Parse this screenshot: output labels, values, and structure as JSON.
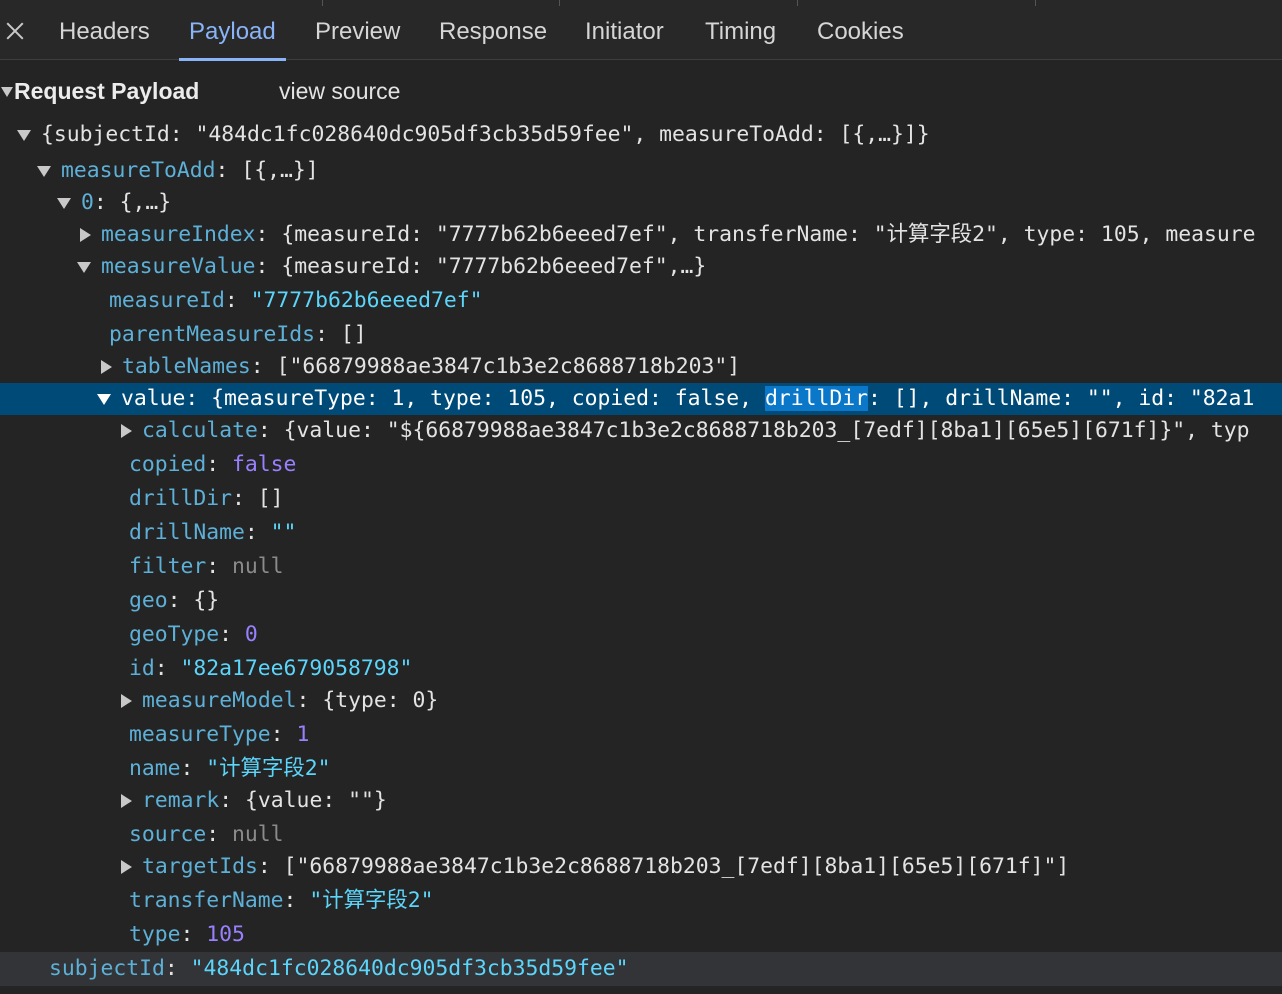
{
  "colors": {
    "background": "#242424",
    "selected_row": "#004a77",
    "accent_tab": "#8ab4f8",
    "key": "#5db0d7",
    "string": "#5cd5fb",
    "number": "#9980ff",
    "null": "#8b8b8b"
  },
  "tabs": [
    "Headers",
    "Payload",
    "Preview",
    "Response",
    "Initiator",
    "Timing",
    "Cookies"
  ],
  "active_tab": "Payload",
  "section": {
    "title": "Request Payload",
    "view_source": "view source"
  },
  "tree": {
    "root": {
      "preview": "{subjectId: \"484dc1fc028640dc905df3cb35d59fee\", measureToAdd: [{,…}]}"
    },
    "measureToAdd": {
      "key": "measureToAdd",
      "preview": "[{,…}]"
    },
    "item0": {
      "key": "0",
      "preview": "{,…}"
    },
    "measureIndex": {
      "key": "measureIndex",
      "preview": "{measureId: \"7777b62b6eeed7ef\", transferName: \"计算字段2\", type: 105, measure"
    },
    "measureValue": {
      "key": "measureValue",
      "preview": "{measureId: \"7777b62b6eeed7ef\",…}"
    },
    "mv_measureId": {
      "key": "measureId",
      "value": "\"7777b62b6eeed7ef\""
    },
    "parentMeasureIds": {
      "key": "parentMeasureIds",
      "value": "[]"
    },
    "tableNames": {
      "key": "tableNames",
      "preview": "[\"66879988ae3847c1b3e2c8688718b203\"]"
    },
    "value": {
      "key": "value",
      "preview_before": "{measureType: 1, type: 105, copied: false, ",
      "preview_highlight": "drillDir",
      "preview_after": ": [], drillName: \"\", id: \"82a1"
    },
    "calculate": {
      "key": "calculate",
      "preview": "{value: \"${66879988ae3847c1b3e2c8688718b203_[7edf][8ba1][65e5][671f]}\", typ"
    },
    "copied": {
      "key": "copied",
      "value": "false"
    },
    "drillDir": {
      "key": "drillDir",
      "value": "[]"
    },
    "drillName": {
      "key": "drillName",
      "value": "\"\""
    },
    "filter": {
      "key": "filter",
      "value": "null"
    },
    "geo": {
      "key": "geo",
      "value": "{}"
    },
    "geoType": {
      "key": "geoType",
      "value": "0"
    },
    "id": {
      "key": "id",
      "value": "\"82a17ee679058798\""
    },
    "measureModel": {
      "key": "measureModel",
      "preview": "{type: 0}"
    },
    "measureType": {
      "key": "measureType",
      "value": "1"
    },
    "name": {
      "key": "name",
      "value": "\"计算字段2\""
    },
    "remark": {
      "key": "remark",
      "preview": "{value: \"\"}"
    },
    "source": {
      "key": "source",
      "value": "null"
    },
    "targetIds": {
      "key": "targetIds",
      "preview": "[\"66879988ae3847c1b3e2c8688718b203_[7edf][8ba1][65e5][671f]\"]"
    },
    "transferName": {
      "key": "transferName",
      "value": "\"计算字段2\""
    },
    "type": {
      "key": "type",
      "value": "105"
    },
    "subjectId": {
      "key": "subjectId",
      "value": "\"484dc1fc028640dc905df3cb35d59fee\""
    }
  }
}
